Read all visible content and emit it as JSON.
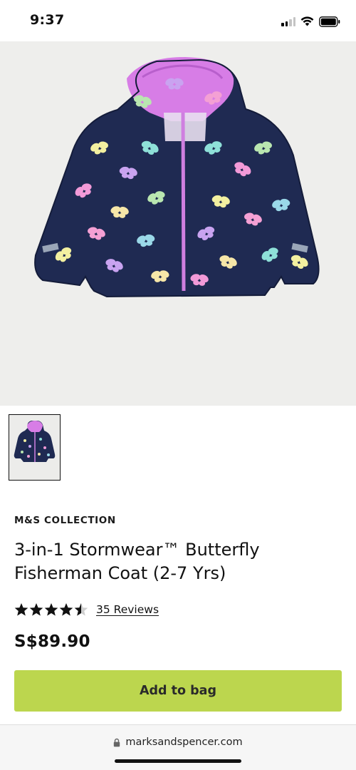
{
  "status_bar": {
    "time": "9:37",
    "icons": [
      "signal-icon",
      "wifi-icon",
      "battery-icon"
    ]
  },
  "product": {
    "image_alt": "Navy hooded raincoat with pink lining and butterfly print",
    "brand": "M&S COLLECTION",
    "title": "3-in-1 Stormwear™ Butterfly Fisherman Coat (2-7 Yrs)",
    "rating": 4.5,
    "reviews_label": "35 Reviews",
    "price": "S$89.90"
  },
  "actions": {
    "add_to_bag": "Add to bag"
  },
  "browser": {
    "url": "marksandspencer.com"
  },
  "colors": {
    "accent": "#bcd64e",
    "coat_navy": "#1f2a52",
    "lining_pink": "#d77de6",
    "hero_bg": "#eeeeec"
  }
}
